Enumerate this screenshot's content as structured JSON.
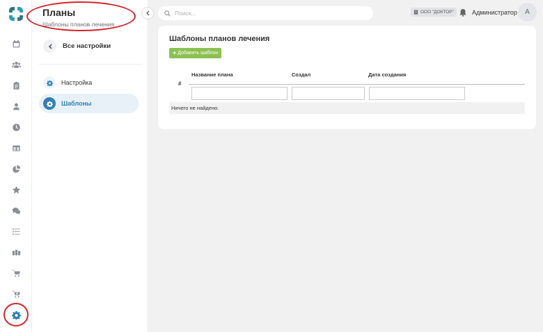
{
  "sidebar": {
    "title": "Планы",
    "subtitle": "Шаблоны планов лечения",
    "back_label": "Все настройки",
    "items": [
      {
        "label": "Настройка"
      },
      {
        "label": "Шаблоны"
      }
    ]
  },
  "rail": {
    "icons": [
      "calendar-icon",
      "users-icon",
      "clipboard-icon",
      "user-icon",
      "clock-icon",
      "table-icon",
      "pie-chart-icon",
      "star-icon",
      "comments-icon",
      "list-icon",
      "group-icon",
      "cart-icon",
      "cart-plus-icon",
      "gear-icon"
    ],
    "active": "gear-icon"
  },
  "topbar": {
    "search_placeholder": "Поиск...",
    "org_label": "ООО \"ДОКТОР\"",
    "user_name": "Администратор",
    "avatar_letter": "А"
  },
  "main": {
    "title": "Шаблоны планов лечения",
    "add_button_label": "Добавить шаблон",
    "table": {
      "columns": [
        "#",
        "Название плана",
        "Создал",
        "Дата создания"
      ],
      "empty_text": "Ничего не найдено."
    }
  },
  "colors": {
    "accent": "#2f7fb3",
    "add_button": "#8cc152",
    "annotation": "#d8232a"
  }
}
